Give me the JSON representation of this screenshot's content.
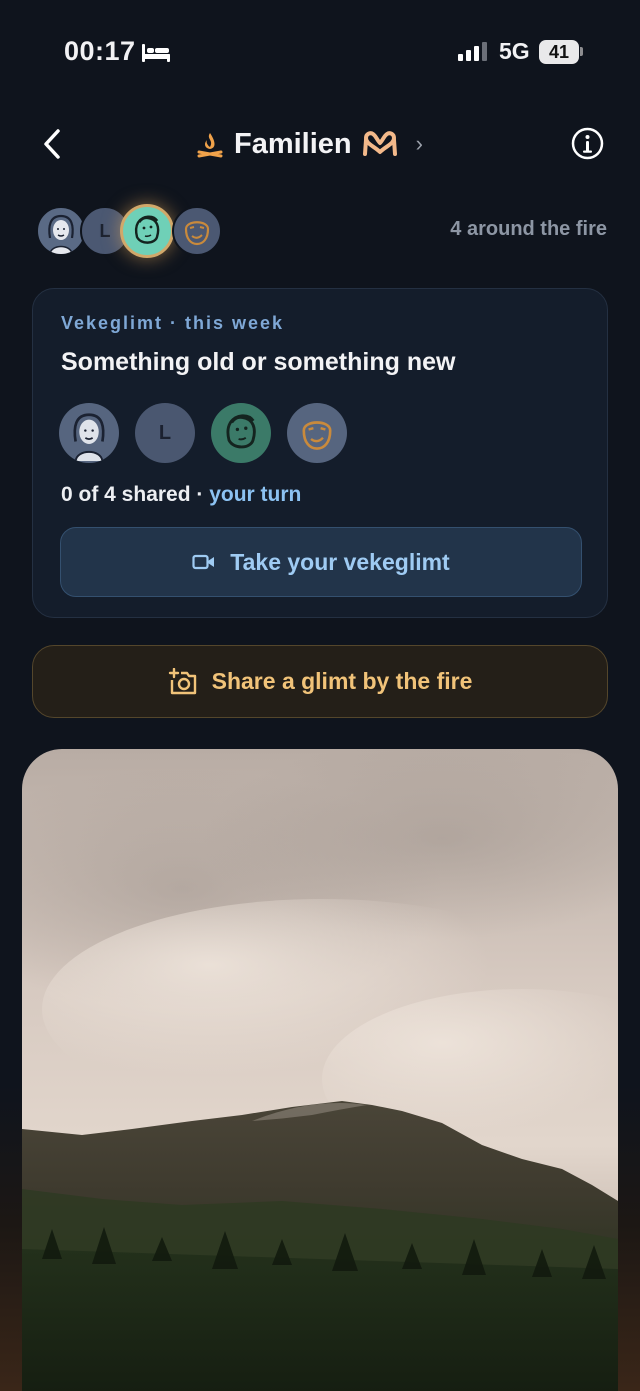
{
  "status_bar": {
    "time": "00:17",
    "network": "5G",
    "battery": "41",
    "signal_bars": 3,
    "signal_total": 4
  },
  "header": {
    "title": "Familien",
    "title_icon": "campfire-icon",
    "title_emoji": "heart-hands-icon"
  },
  "circle": {
    "member_initial": "L",
    "count_text": "4 around the fire"
  },
  "vekeglimt": {
    "kicker": "Vekeglimt · this week",
    "prompt": "Something old or something new",
    "shared_text": "0 of 4 shared · ",
    "turn_text": "your turn",
    "member_initial": "L",
    "take_label": "Take your vekeglimt"
  },
  "share": {
    "label": "Share a glimt by the fire"
  },
  "colors": {
    "background": "#0f141d",
    "accent_blue": "#8cc2f2",
    "accent_gold": "#f1c379",
    "active_avatar": "#6fd0b7"
  }
}
